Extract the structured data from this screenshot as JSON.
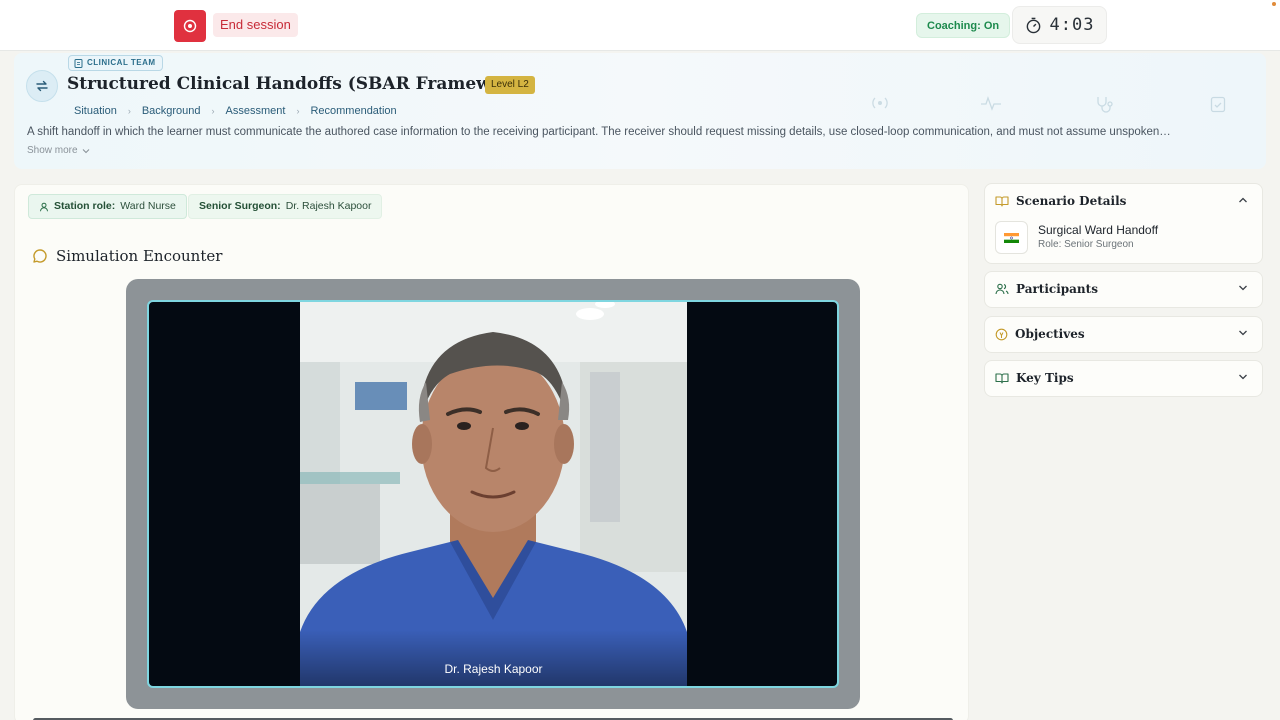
{
  "topbar": {
    "end_session_label": "End session",
    "coaching_label": "Coaching: On",
    "timer": "4:03"
  },
  "header": {
    "team_badge": "CLINICAL TEAM",
    "title": "Structured Clinical Handoffs (SBAR Framework)",
    "level": "Level L2",
    "steps": [
      "Situation",
      "Background",
      "Assessment",
      "Recommendation"
    ],
    "description": "A shift handoff in which the learner must communicate the authored case information to the receiving participant. The receiver should request missing details, use closed-loop communication, and must not assume unspoken…",
    "show_more": "Show more"
  },
  "main": {
    "station_role_label": "Station role:",
    "station_role_value": "Ward Nurse",
    "surgeon_label": "Senior Surgeon:",
    "surgeon_value": "Dr. Rajesh Kapoor",
    "encounter_title": "Simulation Encounter",
    "video_caption": "Dr. Rajesh Kapoor"
  },
  "sidebar": {
    "scenario": {
      "title": "Scenario Details",
      "name": "Surgical Ward Handoff",
      "role": "Role: Senior Surgeon",
      "flag": "🇮🇳"
    },
    "participants": "Participants",
    "objectives": "Objectives",
    "key_tips": "Key Tips"
  },
  "colors": {
    "danger": "#e0313f",
    "coaching": "#1d8a4d",
    "level_badge": "#d4b441",
    "video_border": "#7fd6e0"
  }
}
